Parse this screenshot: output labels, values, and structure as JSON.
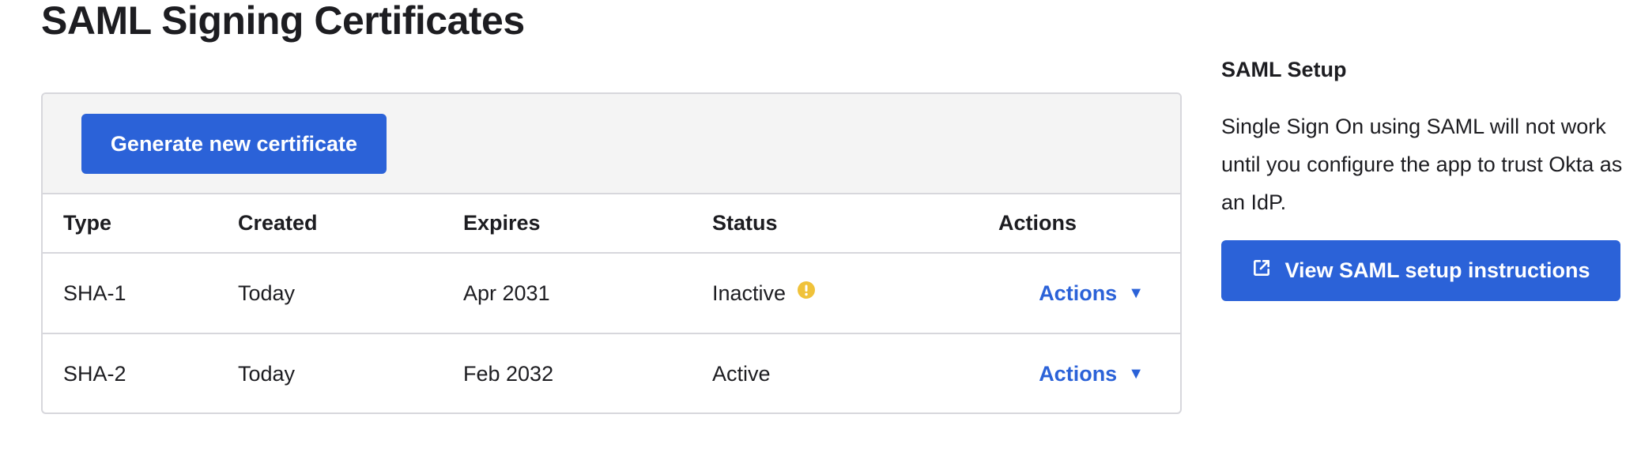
{
  "page": {
    "title": "SAML Signing Certificates"
  },
  "toolbar": {
    "generate_label": "Generate new certificate"
  },
  "table": {
    "headers": {
      "type": "Type",
      "created": "Created",
      "expires": "Expires",
      "status": "Status",
      "actions": "Actions"
    },
    "rows": [
      {
        "type": "SHA-1",
        "created": "Today",
        "expires": "Apr 2031",
        "status": "Inactive",
        "status_icon": "warning-icon",
        "actions_label": "Actions"
      },
      {
        "type": "SHA-2",
        "created": "Today",
        "expires": "Feb 2032",
        "status": "Active",
        "actions_label": "Actions"
      }
    ]
  },
  "sidebar": {
    "heading": "SAML Setup",
    "description": "Single Sign On using SAML will not work until you configure the app to trust Okta as an IdP.",
    "button_label": "View SAML setup instructions",
    "button_icon": "external-link-icon"
  },
  "colors": {
    "primary": "#2b62d8",
    "warning": "#f0c23a",
    "toolbar_bg": "#f4f4f4",
    "border": "#d7d7dc",
    "text": "#1d1d21"
  }
}
